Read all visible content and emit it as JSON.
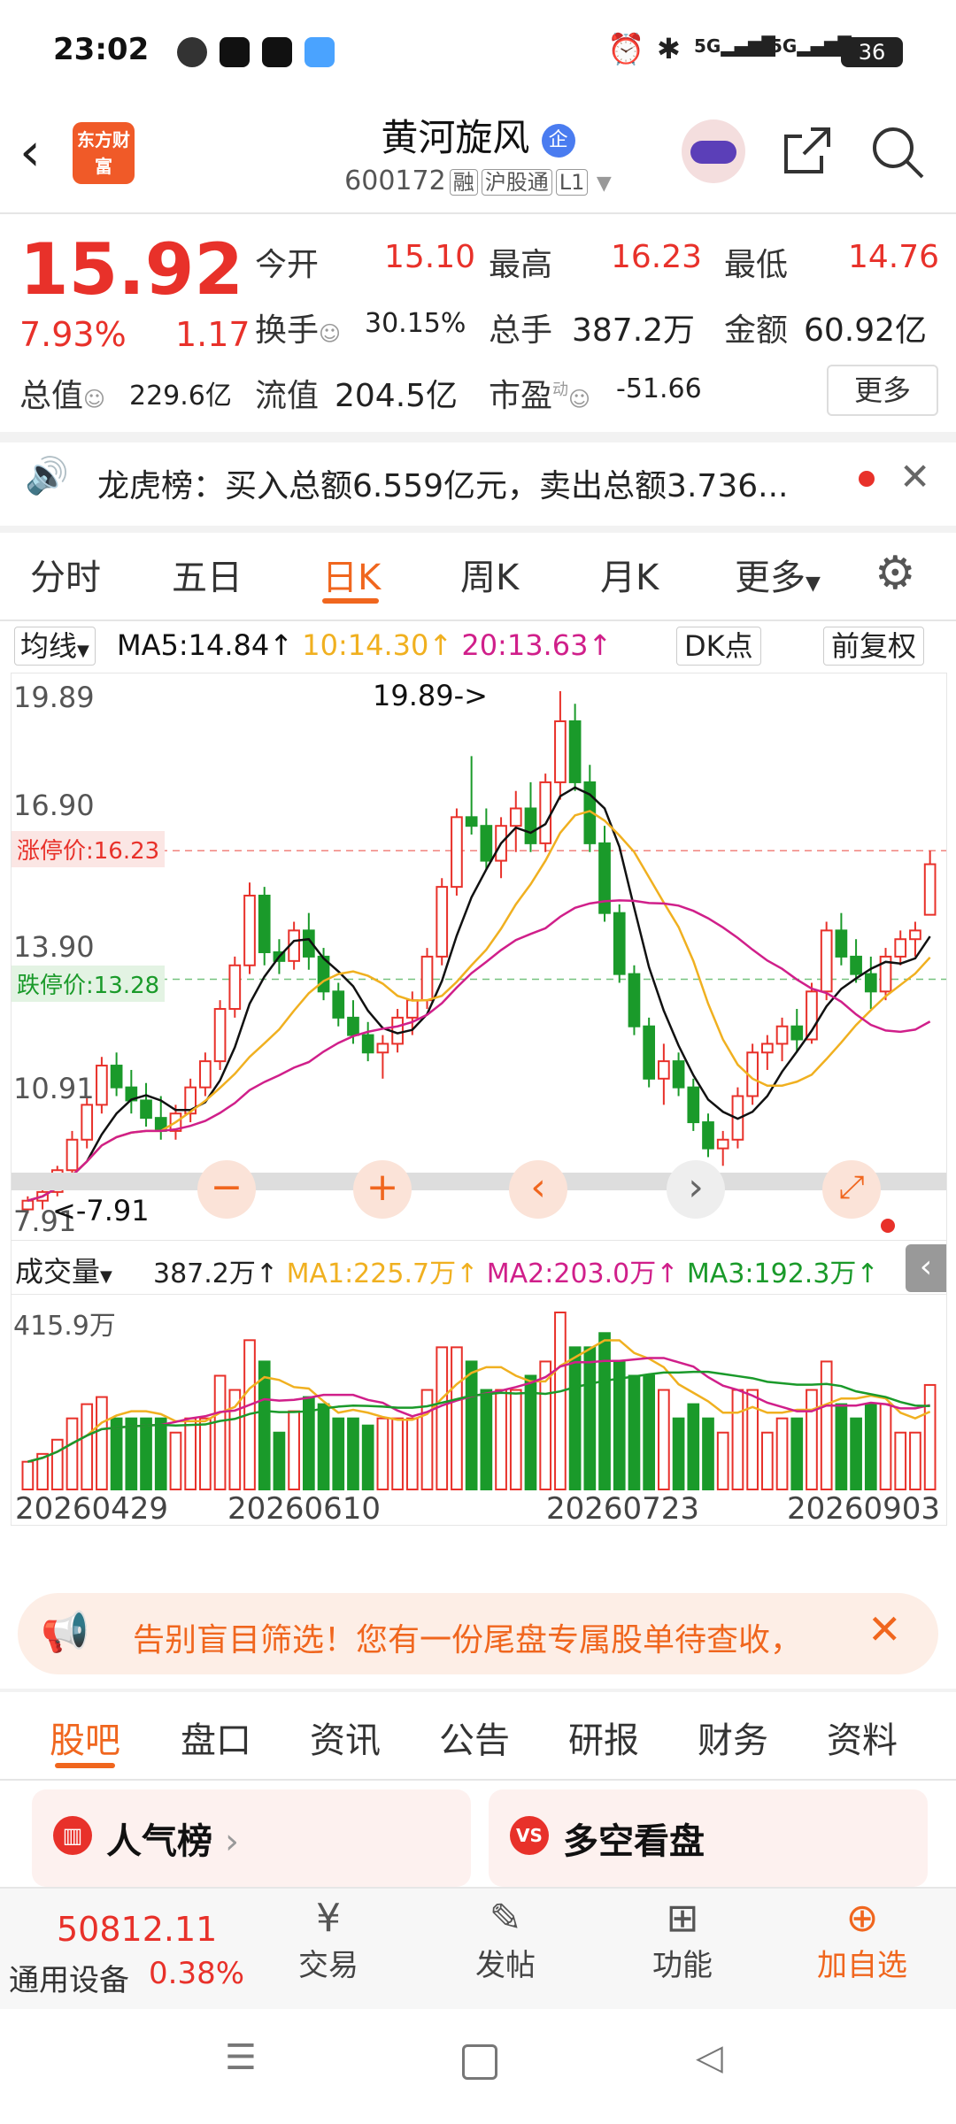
{
  "status_bar": {
    "time": "23:02",
    "battery": "36",
    "signal_1": "5G",
    "signal_2": "5G"
  },
  "header": {
    "back_icon": "chevron-left-icon",
    "logo_text": "东方财富",
    "stock_name": "黄河旋风",
    "stock_code": "600172",
    "tags": [
      "融",
      "沪股通",
      "L1"
    ],
    "share_icon": "share-icon",
    "search_icon": "search-icon"
  },
  "quote": {
    "price": "15.92",
    "change_pct": "7.93%",
    "change_amt": "1.17",
    "open_label": "今开",
    "open": "15.10",
    "high_label": "最高",
    "high": "16.23",
    "low_label": "最低",
    "low": "14.76",
    "turnover_label": "换手",
    "turnover": "30.15%",
    "volume_label": "总手",
    "volume": "387.2万",
    "amount_label": "金额",
    "amount": "60.92亿",
    "mktcap_label": "总值",
    "mktcap": "229.6亿",
    "float_label": "流值",
    "float_cap": "204.5亿",
    "pe_label": "市盈",
    "pe_sup": "动",
    "pe": "-51.66",
    "more_button": "更多"
  },
  "notice": {
    "text": "龙虎榜：买入总额6.559亿元，卖出总额3.736..."
  },
  "chart_tabs": [
    "分时",
    "五日",
    "日K",
    "周K",
    "月K",
    "更多"
  ],
  "active_chart_tab": "日K",
  "kline": {
    "ma_dropdown": "均线",
    "ma5": "MA5:14.84",
    "ma10": "10:14.30",
    "ma20": "20:13.63",
    "dk_button": "DK点",
    "adjust_button": "前复权",
    "y_labels": [
      "19.89",
      "16.90",
      "13.90",
      "10.91",
      "7.91"
    ],
    "max_marker": "19.89->",
    "min_marker": "<-7.91",
    "limit_up": "涨停价:16.23",
    "limit_down": "跌停价:13.28"
  },
  "volume": {
    "dropdown": "成交量",
    "value": "387.2万",
    "ma1": "MA1:225.7万",
    "ma2": "MA2:203.0万",
    "ma3": "MA3:192.3万",
    "y_label": "415.9万",
    "dates": [
      "20260429",
      "20260610",
      "20260723",
      "20260903"
    ]
  },
  "chart_data": {
    "type": "candlestick",
    "ylim": [
      7.91,
      19.89
    ],
    "candles": [
      [
        8.0,
        8.3,
        7.91,
        8.2
      ],
      [
        8.2,
        8.5,
        8.0,
        8.4
      ],
      [
        8.4,
        9.0,
        8.3,
        8.9
      ],
      [
        8.9,
        9.8,
        8.8,
        9.6
      ],
      [
        9.6,
        10.6,
        9.4,
        10.4
      ],
      [
        10.4,
        11.5,
        10.2,
        11.3
      ],
      [
        11.3,
        11.6,
        10.6,
        10.8
      ],
      [
        10.8,
        11.2,
        10.2,
        10.5
      ],
      [
        10.5,
        10.9,
        9.9,
        10.1
      ],
      [
        10.1,
        10.6,
        9.6,
        9.8
      ],
      [
        9.8,
        10.4,
        9.6,
        10.2
      ],
      [
        10.2,
        11.0,
        10.0,
        10.8
      ],
      [
        10.8,
        11.6,
        10.6,
        11.4
      ],
      [
        11.4,
        12.8,
        11.2,
        12.6
      ],
      [
        12.6,
        13.8,
        12.4,
        13.6
      ],
      [
        13.6,
        15.5,
        13.4,
        15.2
      ],
      [
        15.2,
        15.4,
        13.6,
        13.9
      ],
      [
        13.9,
        14.2,
        13.4,
        13.7
      ],
      [
        13.7,
        14.6,
        13.5,
        14.4
      ],
      [
        14.4,
        14.8,
        13.5,
        13.8
      ],
      [
        13.8,
        14.0,
        12.8,
        13.0
      ],
      [
        13.0,
        13.2,
        12.2,
        12.4
      ],
      [
        12.4,
        12.8,
        11.8,
        12.0
      ],
      [
        12.0,
        12.3,
        11.4,
        11.6
      ],
      [
        11.6,
        12.0,
        11.0,
        11.8
      ],
      [
        11.8,
        12.6,
        11.6,
        12.4
      ],
      [
        12.4,
        13.0,
        12.0,
        12.8
      ],
      [
        12.8,
        14.0,
        12.6,
        13.8
      ],
      [
        13.8,
        15.6,
        13.6,
        15.4
      ],
      [
        15.4,
        17.2,
        15.2,
        17.0
      ],
      [
        17.0,
        18.4,
        16.6,
        16.8
      ],
      [
        16.8,
        17.2,
        15.8,
        16.0
      ],
      [
        16.0,
        17.0,
        15.6,
        16.8
      ],
      [
        16.8,
        17.6,
        16.2,
        17.2
      ],
      [
        17.2,
        17.8,
        16.2,
        16.4
      ],
      [
        16.4,
        18.0,
        16.2,
        17.8
      ],
      [
        17.8,
        19.89,
        17.4,
        19.2
      ],
      [
        19.2,
        19.6,
        17.6,
        17.8
      ],
      [
        17.8,
        18.2,
        16.2,
        16.4
      ],
      [
        16.4,
        16.8,
        14.6,
        14.8
      ],
      [
        14.8,
        15.0,
        13.2,
        13.4
      ],
      [
        13.4,
        13.6,
        12.0,
        12.2
      ],
      [
        12.2,
        12.4,
        10.8,
        11.0
      ],
      [
        11.0,
        11.8,
        10.4,
        11.4
      ],
      [
        11.4,
        11.6,
        10.6,
        10.8
      ],
      [
        10.8,
        11.0,
        9.8,
        10.0
      ],
      [
        10.0,
        10.2,
        9.2,
        9.4
      ],
      [
        9.4,
        9.8,
        9.0,
        9.6
      ],
      [
        9.6,
        10.8,
        9.4,
        10.6
      ],
      [
        10.6,
        11.8,
        10.4,
        11.6
      ],
      [
        11.6,
        12.0,
        11.2,
        11.8
      ],
      [
        11.8,
        12.4,
        11.4,
        12.2
      ],
      [
        12.2,
        12.6,
        11.6,
        11.9
      ],
      [
        11.9,
        13.2,
        11.8,
        13.0
      ],
      [
        13.0,
        14.6,
        12.8,
        14.4
      ],
      [
        14.4,
        14.8,
        13.6,
        13.8
      ],
      [
        13.8,
        14.2,
        13.2,
        13.4
      ],
      [
        13.4,
        13.8,
        12.6,
        13.0
      ],
      [
        13.0,
        14.0,
        12.8,
        13.8
      ],
      [
        13.8,
        14.4,
        13.6,
        14.2
      ],
      [
        14.2,
        14.6,
        13.8,
        14.4
      ],
      [
        14.76,
        16.23,
        14.76,
        15.92
      ]
    ]
  },
  "promo": {
    "text": "告别盲目筛选！您有一份尾盘专属股单待查收，"
  },
  "content_tabs": [
    "股吧",
    "盘口",
    "资讯",
    "公告",
    "研报",
    "财务",
    "资料"
  ],
  "cards": {
    "left": "人气榜",
    "right": "多空看盘"
  },
  "bottom_bar": {
    "index_value": "50812.11",
    "index_name": "通用设备",
    "index_change": "0.38%",
    "nav": [
      "交易",
      "发帖",
      "功能",
      "加自选"
    ]
  },
  "colors": {
    "up": "#e8312a",
    "down": "#1a9a2a",
    "accent": "#f0661e",
    "ma5": "#111111",
    "ma10": "#f0b020",
    "ma20": "#d01f8a"
  }
}
